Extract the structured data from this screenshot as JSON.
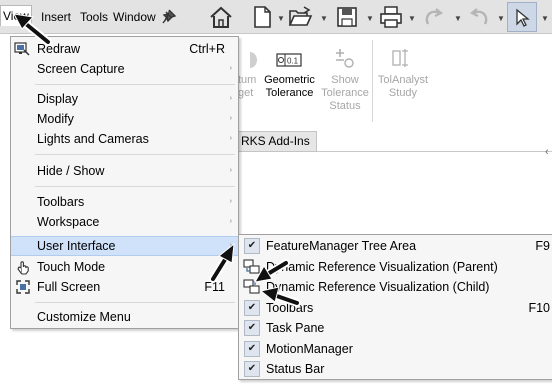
{
  "menubar": {
    "items": [
      "View",
      "Insert",
      "Tools",
      "Window"
    ],
    "pin_icon": "pushpin-icon"
  },
  "toolbar": {
    "icons": [
      "home-icon",
      "new-document-icon",
      "open-folder-icon",
      "save-icon",
      "print-icon",
      "undo-icon",
      "redo-icon",
      "select-cursor-icon"
    ]
  },
  "ribbon": {
    "buttons": [
      {
        "line1": "tum",
        "line2": "get"
      },
      {
        "line1": "Geometric",
        "line2": "Tolerance"
      },
      {
        "line1": "Show",
        "line2": "Tolerance",
        "line3": "Status"
      },
      {
        "line1": "TolAnalyst",
        "line2": "Study"
      }
    ],
    "tab_label": "RKS Add-Ins"
  },
  "view_menu": {
    "items": [
      {
        "label": "Redraw",
        "shortcut": "Ctrl+R",
        "icon": "redraw-icon"
      },
      {
        "label": "Screen Capture",
        "has_submenu": true
      },
      {
        "label": "Display",
        "has_submenu": true
      },
      {
        "label": "Modify",
        "has_submenu": true
      },
      {
        "label": "Lights and Cameras",
        "has_submenu": true
      },
      {
        "label": "Hide / Show",
        "has_submenu": true
      },
      {
        "label": "Toolbars",
        "has_submenu": true
      },
      {
        "label": "Workspace",
        "has_submenu": true
      },
      {
        "label": "User Interface",
        "has_submenu": true,
        "highlighted": true
      },
      {
        "label": "Touch Mode",
        "icon": "touch-hand-icon"
      },
      {
        "label": "Full Screen",
        "shortcut": "F11",
        "icon": "full-screen-icon"
      },
      {
        "label": "Customize Menu"
      }
    ]
  },
  "ui_submenu": {
    "items": [
      {
        "label": "FeatureManager Tree Area",
        "shortcut": "F9",
        "checked": true
      },
      {
        "label": "Dynamic Reference Visualization (Parent)",
        "icon": "dynamic-reference-parent-icon"
      },
      {
        "label": "Dynamic Reference Visualization (Child)",
        "icon": "dynamic-reference-child-icon"
      },
      {
        "label": "Toolbars",
        "shortcut": "F10",
        "checked": true
      },
      {
        "label": "Task Pane",
        "checked": true
      },
      {
        "label": "MotionManager",
        "checked": true
      },
      {
        "label": "Status Bar",
        "checked": true
      }
    ]
  },
  "colors": {
    "highlight": "#cfe2fa",
    "menu_bg": "#f6f6f6",
    "toolbar_bg": "#e3e3e3",
    "selected_tool_bg": "#cdd7e6"
  }
}
